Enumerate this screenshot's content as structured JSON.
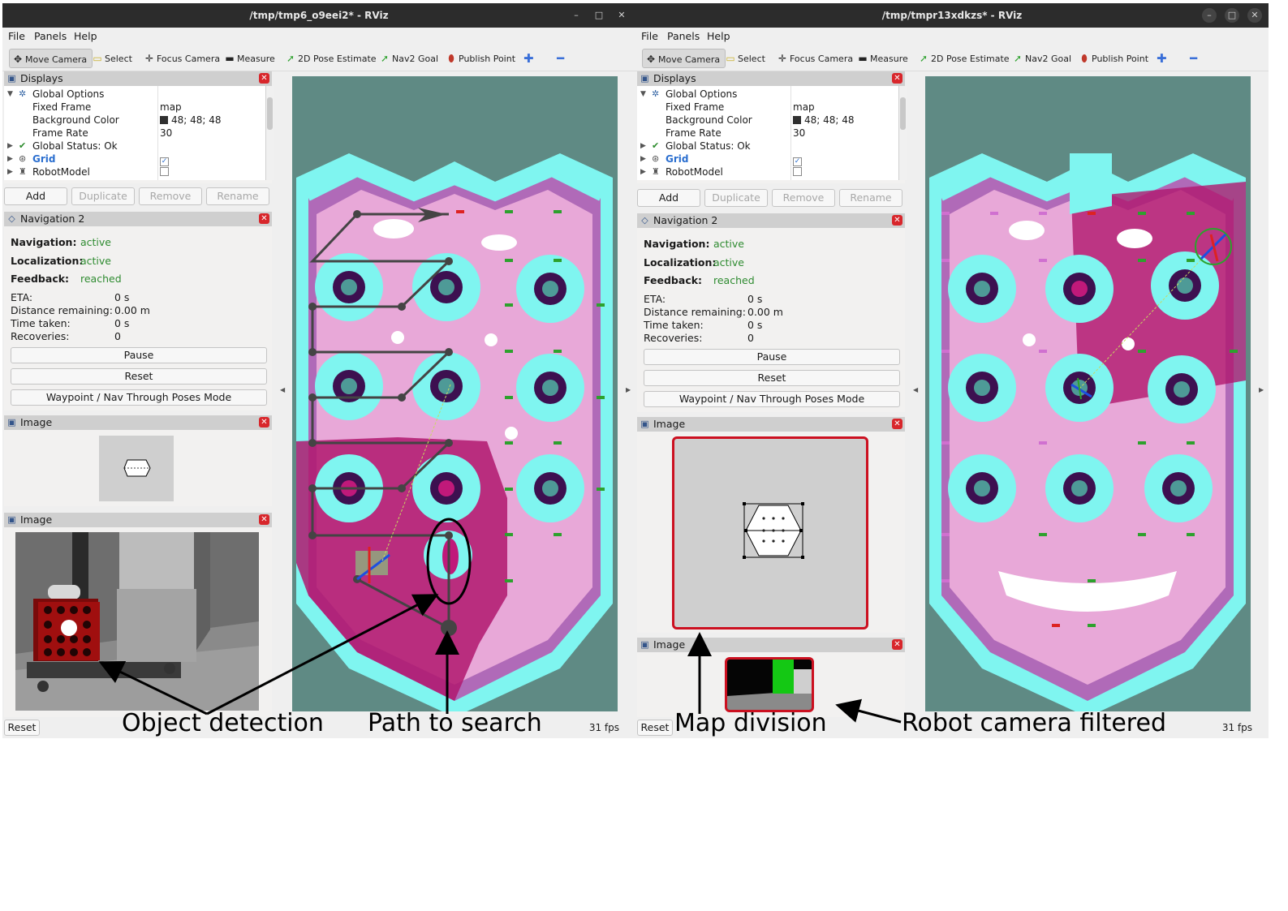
{
  "windows": [
    {
      "title": "/tmp/tmp6_o9eei2* - RViz",
      "menu": [
        "File",
        "Panels",
        "Help"
      ],
      "tools": [
        "Move Camera",
        "Select",
        "Focus Camera",
        "Measure",
        "2D Pose Estimate",
        "Nav2 Goal",
        "Publish Point"
      ],
      "displays": {
        "title": "Displays",
        "rows": [
          {
            "label": "Global Options",
            "value": ""
          },
          {
            "label": "Fixed Frame",
            "value": "map"
          },
          {
            "label": "Background Color",
            "value": "48; 48; 48"
          },
          {
            "label": "Frame Rate",
            "value": "30"
          },
          {
            "label": "Global Status: Ok",
            "value": ""
          },
          {
            "label": "Grid",
            "value": ""
          },
          {
            "label": "RobotModel",
            "value": ""
          }
        ],
        "buttons": [
          "Add",
          "Duplicate",
          "Remove",
          "Rename"
        ]
      },
      "navigation": {
        "title": "Navigation 2",
        "navigation_label": "Navigation:",
        "navigation_value": "active",
        "localization_label": "Localization:",
        "localization_value": "active",
        "feedback_label": "Feedback:",
        "feedback_value": "reached",
        "eta_label": "ETA:",
        "eta_value": "0 s",
        "distance_label": "Distance remaining:",
        "distance_value": "0.00 m",
        "time_label": "Time taken:",
        "time_value": "0 s",
        "recoveries_label": "Recoveries:",
        "recoveries_value": "0",
        "pause": "Pause",
        "reset": "Reset",
        "mode": "Waypoint / Nav Through Poses Mode"
      },
      "image_panels": [
        "Image",
        "Image"
      ],
      "reset": "Reset",
      "fps": "31 fps"
    },
    {
      "title": "/tmp/tmpr13xdkzs* - RViz",
      "menu": [
        "File",
        "Panels",
        "Help"
      ],
      "tools": [
        "Move Camera",
        "Select",
        "Focus Camera",
        "Measure",
        "2D Pose Estimate",
        "Nav2 Goal",
        "Publish Point"
      ],
      "displays": {
        "title": "Displays",
        "rows": [
          {
            "label": "Global Options",
            "value": ""
          },
          {
            "label": "Fixed Frame",
            "value": "map"
          },
          {
            "label": "Background Color",
            "value": "48; 48; 48"
          },
          {
            "label": "Frame Rate",
            "value": "30"
          },
          {
            "label": "Global Status: Ok",
            "value": ""
          },
          {
            "label": "Grid",
            "value": ""
          },
          {
            "label": "RobotModel",
            "value": ""
          }
        ],
        "buttons": [
          "Add",
          "Duplicate",
          "Remove",
          "Rename"
        ]
      },
      "navigation": {
        "title": "Navigation 2",
        "navigation_label": "Navigation:",
        "navigation_value": "active",
        "localization_label": "Localization:",
        "localization_value": "active",
        "feedback_label": "Feedback:",
        "feedback_value": "reached",
        "eta_label": "ETA:",
        "eta_value": "0 s",
        "distance_label": "Distance remaining:",
        "distance_value": "0.00 m",
        "time_label": "Time taken:",
        "time_value": "0 s",
        "recoveries_label": "Recoveries:",
        "recoveries_value": "0",
        "pause": "Pause",
        "reset": "Reset",
        "mode": "Waypoint / Nav Through Poses Mode"
      },
      "image_panels": [
        "Image",
        "Image"
      ],
      "reset": "Reset",
      "fps": "31 fps"
    }
  ],
  "annotations": {
    "object_detection": "Object detection",
    "path_to_search": "Path to search",
    "map_division": "Map division",
    "robot_camera_filtered": "Robot camera filtered"
  },
  "colors": {
    "costmap_outer": "#5f8a84",
    "costmap_cyan": "#7ff5f0",
    "costmap_pink": "#e8a8d8",
    "costmap_magenta": "#b0186e",
    "obstacle": "#3d1050",
    "highlight_red": "#cc1020"
  }
}
